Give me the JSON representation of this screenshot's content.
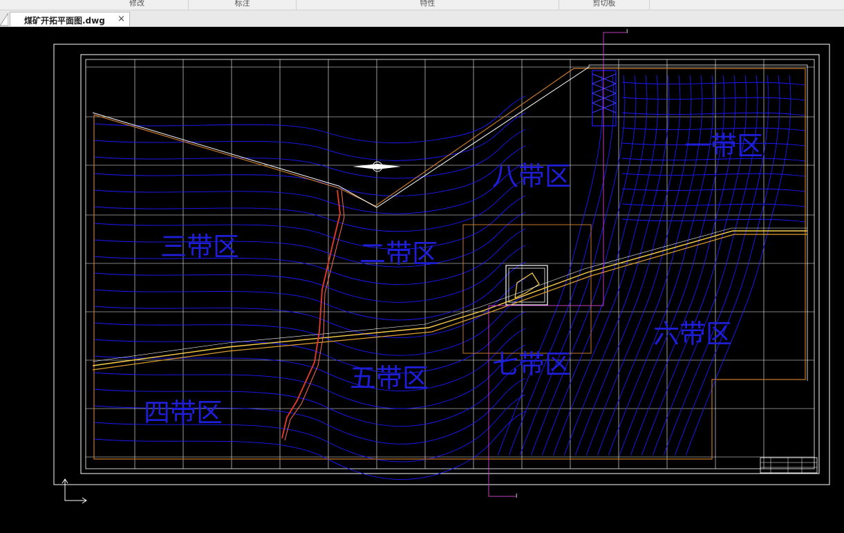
{
  "ribbon": {
    "groups": [
      "修改",
      "标注",
      "特性",
      "剪切板"
    ]
  },
  "document_tab": {
    "title": "煤矿开拓平面图.dwg",
    "close_glyph": "×"
  },
  "drawing": {
    "zones": {
      "zone_1": "一带区",
      "zone_2": "二带区",
      "zone_3": "三带区",
      "zone_4": "四带区",
      "zone_5": "五带区",
      "zone_6": "六带区",
      "zone_7": "七带区",
      "zone_8": "八带区"
    },
    "section_marks": {
      "top": "I",
      "bottom": "I"
    },
    "colors": {
      "background": "#000000",
      "grid": "#ffffff",
      "contour": "#1a1aff",
      "boundary": "#c8782a",
      "roadway": "#ffd24a",
      "fault": "#d83a2a",
      "section_line": "#c040c0",
      "zone_label": "#1e1ed6"
    }
  }
}
